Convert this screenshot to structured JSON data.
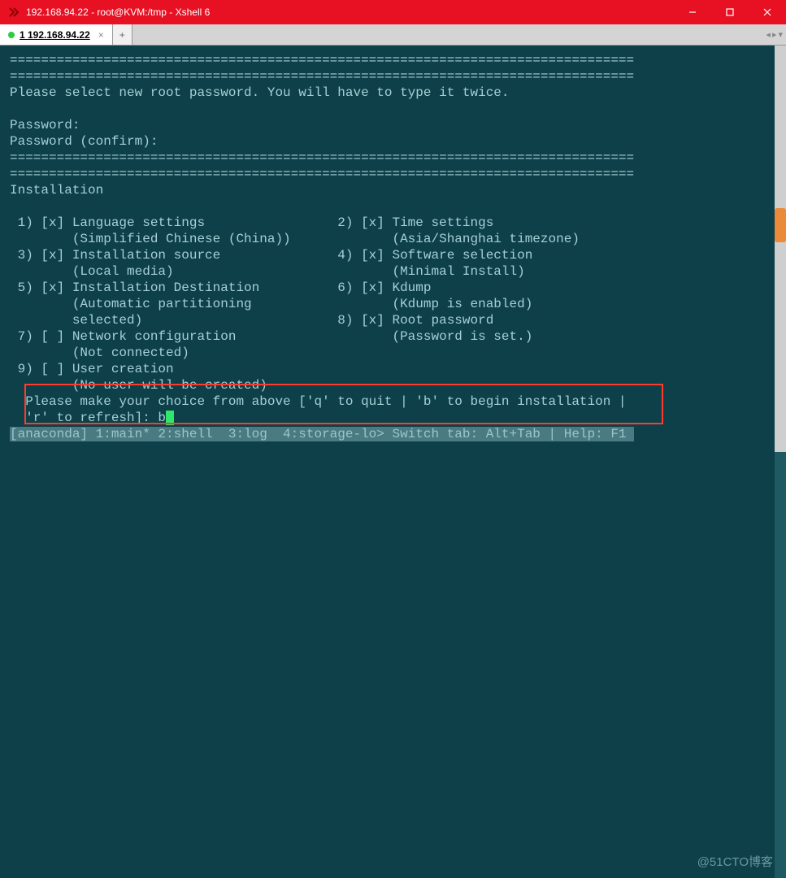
{
  "window": {
    "title": "192.168.94.22 - root@KVM:/tmp - Xshell 6",
    "tab_label": "1 192.168.94.22",
    "tab_close": "×",
    "add_tab": "+",
    "nav_left": "◂",
    "nav_right": "▸",
    "nav_menu": "▾"
  },
  "separator_line": "================================================================================",
  "lines": {
    "password_header": "Please select new root password. You will have to type it twice.",
    "password_prompt": "Password: ",
    "password_confirm": "Password (confirm): ",
    "install_header": "Installation",
    "install_1": " 1) [x] Language settings                 2) [x] Time settings",
    "install_1b": "        (Simplified Chinese (China))             (Asia/Shanghai timezone)",
    "install_3": " 3) [x] Installation source               4) [x] Software selection",
    "install_3b": "        (Local media)                            (Minimal Install)",
    "install_5": " 5) [x] Installation Destination          6) [x] Kdump",
    "install_5b": "        (Automatic partitioning                  (Kdump is enabled)",
    "install_5c": "        selected)                         8) [x] Root password",
    "install_7": " 7) [ ] Network configuration                    (Password is set.)",
    "install_7b": "        (Not connected)",
    "install_9": " 9) [ ] User creation",
    "install_9b": "        (No user will be created)",
    "prompt1": "  Please make your choice from above ['q' to quit | 'b' to begin installation |",
    "prompt2": "  'r' to refresh]: b",
    "statusbar": "[anaconda] 1:main* 2:shell  3:log  4:storage-lo> Switch tab: Alt+Tab | Help: F1 "
  },
  "watermark": "@51CTO博客"
}
